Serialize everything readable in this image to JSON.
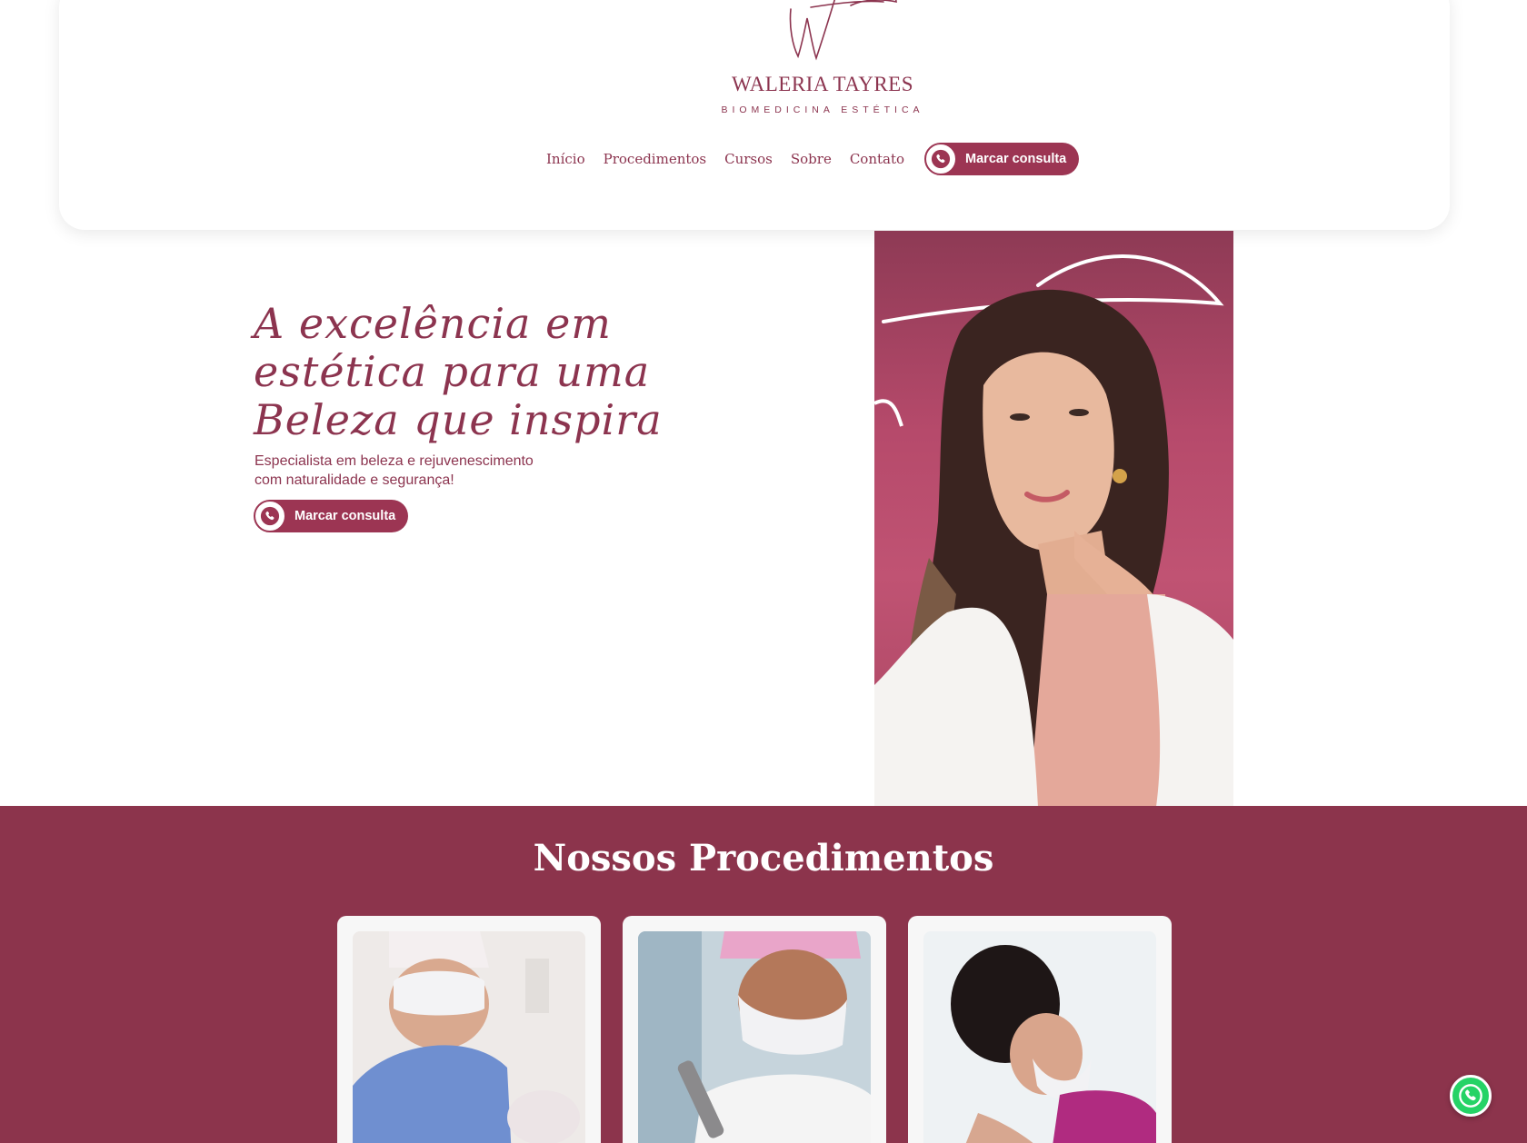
{
  "brand": {
    "name": "WALERIA TAYRES",
    "tagline": "BIOMEDICINA ESTÉTICA",
    "color": "#8c344f"
  },
  "nav": {
    "items": [
      {
        "label": "Início"
      },
      {
        "label": "Procedimentos"
      },
      {
        "label": "Cursos"
      },
      {
        "label": "Sobre"
      },
      {
        "label": "Contato"
      }
    ],
    "cta_label": "Marcar consulta"
  },
  "hero": {
    "title_lines": [
      "A excelência em",
      "estética para uma",
      "Beleza que inspira"
    ],
    "subtitle_lines": [
      "Especialista em beleza e rejuvenescimento",
      "com naturalidade e segurança!"
    ],
    "cta_label": "Marcar consulta"
  },
  "procedures": {
    "title": "Nossos Procedimentos",
    "background": "#8c344c"
  },
  "icons": {
    "whatsapp": "whatsapp-icon",
    "floating": "whatsapp-float-icon"
  }
}
